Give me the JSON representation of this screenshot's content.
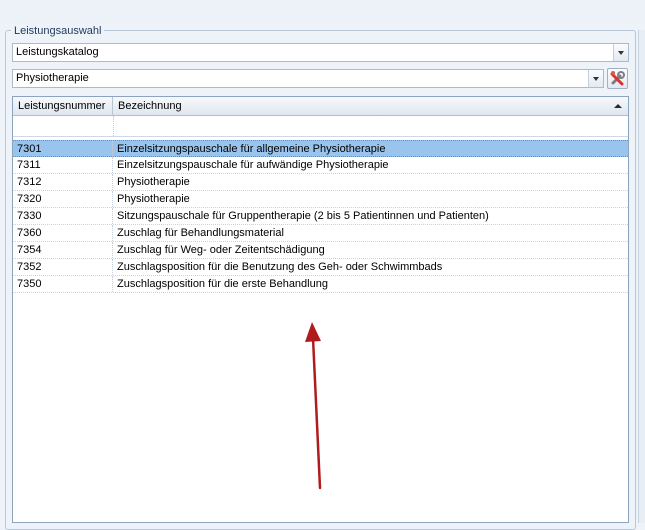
{
  "group": {
    "title": "Leistungsauswahl"
  },
  "catalog_select": {
    "value": "Leistungskatalog"
  },
  "category_select": {
    "value": "Physiotherapie"
  },
  "tools": {
    "icon": "wrench-icon"
  },
  "table": {
    "columns": [
      "Leistungsnummer",
      "Bezeichnung"
    ],
    "sort": "ascending",
    "selected_index": 0,
    "rows": [
      {
        "nummer": "7301",
        "bezeichnung": "Einzelsitzungspauschale für allgemeine Physiotherapie"
      },
      {
        "nummer": "7311",
        "bezeichnung": "Einzelsitzungspauschale für aufwändige Physiotherapie"
      },
      {
        "nummer": "7312",
        "bezeichnung": "Physiotherapie"
      },
      {
        "nummer": "7320",
        "bezeichnung": "Physiotherapie"
      },
      {
        "nummer": "7330",
        "bezeichnung": "Sitzungspauschale für Gruppentherapie (2 bis 5 Patientinnen und Patienten)"
      },
      {
        "nummer": "7360",
        "bezeichnung": "Zuschlag für Behandlungsmaterial"
      },
      {
        "nummer": "7354",
        "bezeichnung": "Zuschlag für Weg- oder Zeitentschädigung"
      },
      {
        "nummer": "7352",
        "bezeichnung": "Zuschlagsposition für die Benutzung des Geh- oder Schwimmbads"
      },
      {
        "nummer": "7350",
        "bezeichnung": "Zuschlagsposition für die erste Behandlung"
      }
    ]
  },
  "colors": {
    "selection": "#99c4ed",
    "annotation_arrow": "#b01c1c"
  }
}
